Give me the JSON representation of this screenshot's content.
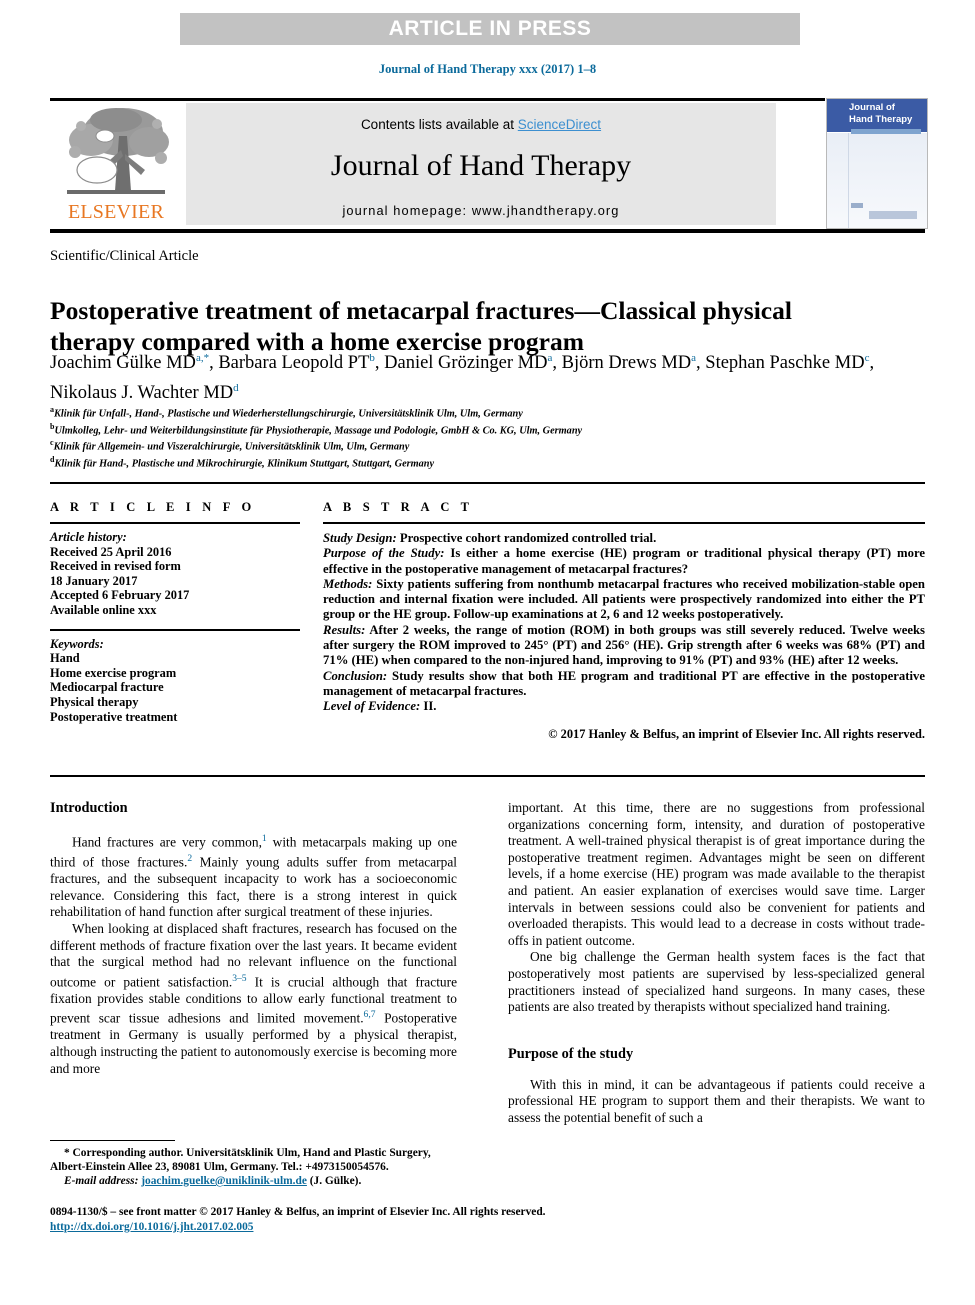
{
  "banner": {
    "label": "ARTICLE IN PRESS"
  },
  "running_head": "Journal of Hand Therapy xxx (2017) 1–8",
  "masthead": {
    "contents_prefix": "Contents lists available at ",
    "sciencedirect": "ScienceDirect",
    "journal_title": "Journal of Hand Therapy",
    "homepage": "journal homepage: www.jhandtherapy.org",
    "publisher_wordmark": "ELSEVIER",
    "cover_title": "Journal of\nHand Therapy"
  },
  "article": {
    "type": "Scientific/Clinical Article",
    "title": "Postoperative treatment of metacarpal fractures—Classical physical therapy compared with a home exercise program",
    "authors_line_1": "Joachim Gülke MD",
    "authors": [
      {
        "name": "Joachim Gülke MD",
        "marks": "a,*",
        "sep": ", "
      },
      {
        "name": "Barbara Leopold PT",
        "marks": "b",
        "sep": ", "
      },
      {
        "name": "Daniel Grözinger MD",
        "marks": "a",
        "sep": ", "
      },
      {
        "name": "Björn Drews MD",
        "marks": "a",
        "sep": ", "
      },
      {
        "name": "Stephan Paschke MD",
        "marks": "c",
        "sep": ", "
      },
      {
        "name": "Nikolaus J. Wachter MD",
        "marks": "d",
        "sep": ""
      }
    ],
    "affiliations": [
      {
        "mark": "a",
        "text": "Klinik für Unfall-, Hand-, Plastische und Wiederherstellungschirurgie, Universitätsklinik Ulm, Ulm, Germany"
      },
      {
        "mark": "b",
        "text": "Ulmkolleg, Lehr- und Weiterbildungsinstitute für Physiotherapie, Massage und Podologie, GmbH & Co. KG, Ulm, Germany"
      },
      {
        "mark": "c",
        "text": "Klinik für Allgemein- und Viszeralchirurgie, Universitätsklinik Ulm, Ulm, Germany"
      },
      {
        "mark": "d",
        "text": "Klinik für Hand-, Plastische und Mikrochirurgie, Klinikum Stuttgart, Stuttgart, Germany"
      }
    ]
  },
  "article_info": {
    "heading": "A R T I C L E  I N F O",
    "history_label": "Article history:",
    "history": [
      "Received 25 April 2016",
      "Received in revised form",
      "18 January 2017",
      "Accepted 6 February 2017",
      "Available online xxx"
    ],
    "keywords_label": "Keywords:",
    "keywords": [
      "Hand",
      "Home exercise program",
      "Mediocarpal fracture",
      "Physical therapy",
      "Postoperative treatment"
    ]
  },
  "abstract": {
    "heading": "A B S T R A C T",
    "sections": [
      {
        "label": "Study Design:",
        "text": " Prospective cohort randomized controlled trial."
      },
      {
        "label": "Purpose of the Study:",
        "text": " Is either a home exercise (HE) program or traditional physical therapy (PT) more effective in the postoperative management of metacarpal fractures?"
      },
      {
        "label": "Methods:",
        "text": " Sixty patients suffering from nonthumb metacarpal fractures who received mobilization-stable open reduction and internal fixation were included. All patients were prospectively randomized into either the PT group or the HE group. Follow-up examinations at 2, 6 and 12 weeks postoperatively."
      },
      {
        "label": "Results:",
        "text": " After 2 weeks, the range of motion (ROM) in both groups was still severely reduced. Twelve weeks after surgery the ROM improved to 245° (PT) and 256° (HE). Grip strength after 6 weeks was 68% (PT) and 71% (HE) when compared to the non-injured hand, improving to 91% (PT) and 93% (HE) after 12 weeks."
      },
      {
        "label": "Conclusion:",
        "text": " Study results show that both HE program and traditional PT are effective in the postoperative management of metacarpal fractures."
      },
      {
        "label": "Level of Evidence:",
        "text": " II."
      }
    ],
    "copyright": "© 2017 Hanley & Belfus, an imprint of Elsevier Inc. All rights reserved."
  },
  "body": {
    "left": {
      "heading": "Introduction",
      "paragraph_1_a": "Hand fractures are very common,",
      "paragraph_1_ref1": "1",
      "paragraph_1_b": " with metacarpals making up one third of those fractures.",
      "paragraph_1_ref2": "2",
      "paragraph_1_c": " Mainly young adults suffer from metacarpal fractures, and the subsequent incapacity to work has a socioeconomic relevance. Considering this fact, there is a strong interest in quick rehabilitation of hand function after surgical treatment of these injuries.",
      "paragraph_2_a": "When looking at displaced shaft fractures, research has focused on the different methods of fracture fixation over the last years. It became evident that the surgical method had no relevant influence on the functional outcome or patient satisfaction.",
      "paragraph_2_ref1": "3–5",
      "paragraph_2_b": " It is crucial although that fracture fixation provides stable conditions to allow early functional treatment to prevent scar tissue adhesions and limited movement.",
      "paragraph_2_ref2": "6,7",
      "paragraph_2_c": " Postoperative treatment in Germany is usually performed by a physical therapist, although instructing the patient to autonomously exercise is becoming more and more"
    },
    "right": {
      "paragraph_1": "important. At this time, there are no suggestions from professional organizations concerning form, intensity, and duration of postoperative treatment. A well-trained physical therapist is of great importance during the postoperative treatment regimen. Advantages might be seen on different levels, if a home exercise (HE) program was made available to the therapist and patient. An easier explanation of exercises would save time. Larger intervals in between sessions could also be convenient for patients and overloaded therapists. This would lead to a decrease in costs without trade-offs in patient outcome.",
      "paragraph_2": "One big challenge the German health system faces is the fact that postoperatively most patients are supervised by less-specialized general practitioners instead of specialized hand surgeons. In many cases, these patients are also treated by therapists without specialized hand training.",
      "heading_2": "Purpose of the study",
      "paragraph_3": "With this in mind, it can be advantageous if patients could receive a professional HE program to support them and their therapists. We want to assess the potential benefit of such a"
    }
  },
  "footnotes": {
    "corresponding": "* Corresponding author. Universitätsklinik Ulm, Hand and Plastic Surgery, Albert-Einstein Allee 23, 89081 Ulm, Germany. Tel.: +4973150054576.",
    "email_label": "E-mail address:",
    "email": "joachim.guelke@uniklinik-ulm.de",
    "email_suffix": " (J. Gülke).",
    "issn_line": "0894-1130/$ – see front matter © 2017 Hanley & Belfus, an imprint of Elsevier Inc. All rights reserved.",
    "doi": "http://dx.doi.org/10.1016/j.jht.2017.02.005"
  },
  "colors": {
    "band_gray": "#c2c2c2",
    "link_blue": "#0b6a9b",
    "sciencedirect_blue": "#3c8fd0",
    "elsevier_orange": "#E87722",
    "cover_blue": "#3b5ba5"
  }
}
